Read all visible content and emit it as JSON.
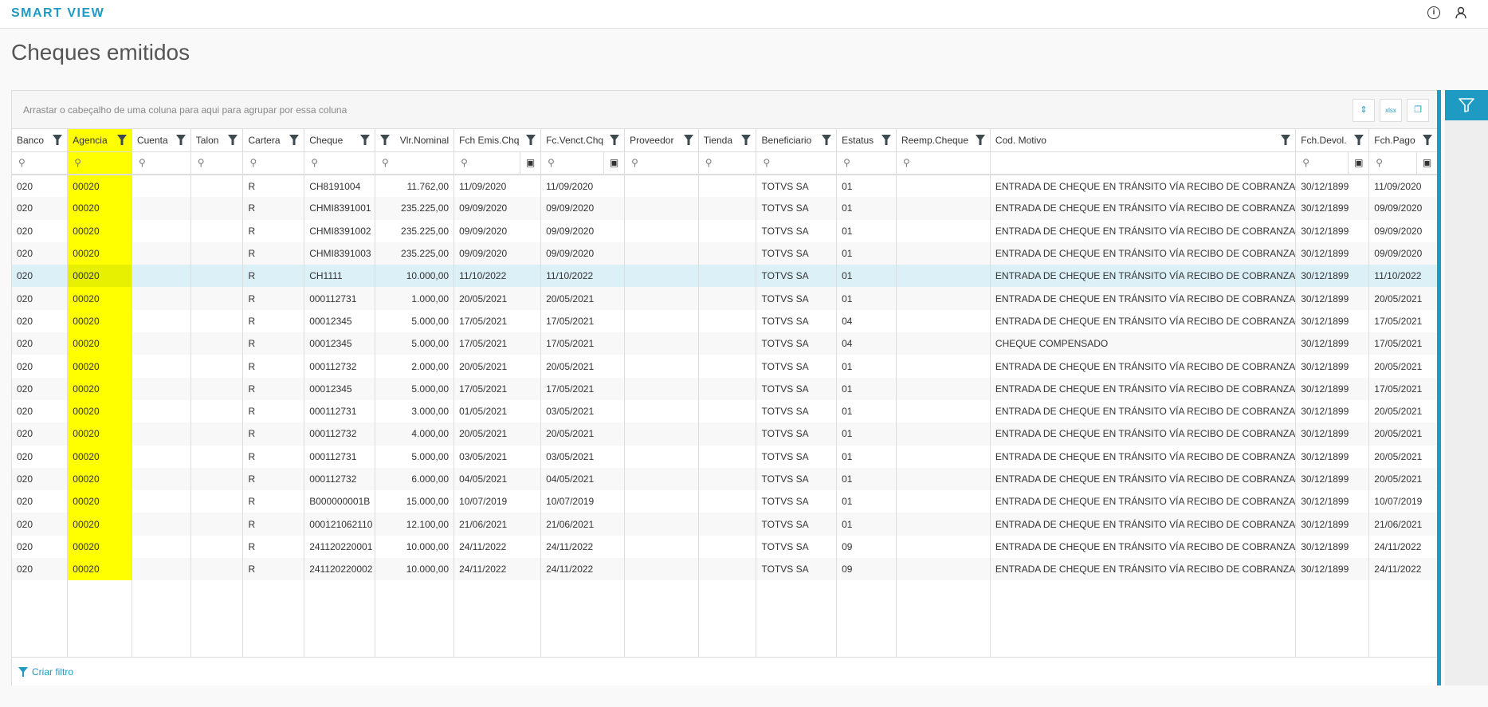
{
  "app": {
    "brand": "SMART VIEW",
    "info_icon": "info-icon",
    "user_icon": "user-icon"
  },
  "page": {
    "title": "Cheques emitidos"
  },
  "grid": {
    "group_hint": "Arrastar o cabeçalho de uma coluna para aqui para agrupar por essa coluna",
    "toolbar": {
      "compact_icon": "row-height-icon",
      "xlsx_icon": "export-xlsx-icon",
      "columns_icon": "columns-icon"
    },
    "highlight_color": "#ffff00",
    "accent_color": "#1f9ac2",
    "columns": [
      "Banco",
      "Agencia",
      "Cuenta",
      "Talon",
      "Cartera",
      "Cheque",
      "Vlr.Nominal",
      "Fch Emis.Chq",
      "Fc.Venct.Chq",
      "Proveedor",
      "Tienda",
      "Beneficiario",
      "Estatus",
      "Reemp.Cheque",
      "Cod. Motivo",
      "Fch.Devol.",
      "Fch.Pago"
    ],
    "selected_row": 4,
    "rows": [
      [
        "020",
        "00020",
        "",
        "",
        "R",
        "CH8191004",
        "11.762,00",
        "11/09/2020",
        "11/09/2020",
        "",
        "",
        "TOTVS SA",
        "01",
        "",
        "ENTRADA DE CHEQUE EN TRÁNSITO VÍA RECIBO DE COBRANZA",
        "30/12/1899",
        "11/09/2020"
      ],
      [
        "020",
        "00020",
        "",
        "",
        "R",
        "CHMI8391001",
        "235.225,00",
        "09/09/2020",
        "09/09/2020",
        "",
        "",
        "TOTVS SA",
        "01",
        "",
        "ENTRADA DE CHEQUE EN TRÁNSITO VÍA RECIBO DE COBRANZA",
        "30/12/1899",
        "09/09/2020"
      ],
      [
        "020",
        "00020",
        "",
        "",
        "R",
        "CHMI8391002",
        "235.225,00",
        "09/09/2020",
        "09/09/2020",
        "",
        "",
        "TOTVS SA",
        "01",
        "",
        "ENTRADA DE CHEQUE EN TRÁNSITO VÍA RECIBO DE COBRANZA",
        "30/12/1899",
        "09/09/2020"
      ],
      [
        "020",
        "00020",
        "",
        "",
        "R",
        "CHMI8391003",
        "235.225,00",
        "09/09/2020",
        "09/09/2020",
        "",
        "",
        "TOTVS SA",
        "01",
        "",
        "ENTRADA DE CHEQUE EN TRÁNSITO VÍA RECIBO DE COBRANZA",
        "30/12/1899",
        "09/09/2020"
      ],
      [
        "020",
        "00020",
        "",
        "",
        "R",
        "CH1111",
        "10.000,00",
        "11/10/2022",
        "11/10/2022",
        "",
        "",
        "TOTVS SA",
        "01",
        "",
        "ENTRADA DE CHEQUE EN TRÁNSITO VÍA RECIBO DE COBRANZA",
        "30/12/1899",
        "11/10/2022"
      ],
      [
        "020",
        "00020",
        "",
        "",
        "R",
        "000112731",
        "1.000,00",
        "20/05/2021",
        "20/05/2021",
        "",
        "",
        "TOTVS SA",
        "01",
        "",
        "ENTRADA DE CHEQUE EN TRÁNSITO VÍA RECIBO DE COBRANZA",
        "30/12/1899",
        "20/05/2021"
      ],
      [
        "020",
        "00020",
        "",
        "",
        "R",
        "00012345",
        "5.000,00",
        "17/05/2021",
        "17/05/2021",
        "",
        "",
        "TOTVS SA",
        "04",
        "",
        "ENTRADA DE CHEQUE EN TRÁNSITO VÍA RECIBO DE COBRANZA",
        "30/12/1899",
        "17/05/2021"
      ],
      [
        "020",
        "00020",
        "",
        "",
        "R",
        "00012345",
        "5.000,00",
        "17/05/2021",
        "17/05/2021",
        "",
        "",
        "TOTVS SA",
        "04",
        "",
        "CHEQUE COMPENSADO",
        "30/12/1899",
        "17/05/2021"
      ],
      [
        "020",
        "00020",
        "",
        "",
        "R",
        "000112732",
        "2.000,00",
        "20/05/2021",
        "20/05/2021",
        "",
        "",
        "TOTVS SA",
        "01",
        "",
        "ENTRADA DE CHEQUE EN TRÁNSITO VÍA RECIBO DE COBRANZA",
        "30/12/1899",
        "20/05/2021"
      ],
      [
        "020",
        "00020",
        "",
        "",
        "R",
        "00012345",
        "5.000,00",
        "17/05/2021",
        "17/05/2021",
        "",
        "",
        "TOTVS SA",
        "01",
        "",
        "ENTRADA DE CHEQUE EN TRÁNSITO VÍA RECIBO DE COBRANZA",
        "30/12/1899",
        "17/05/2021"
      ],
      [
        "020",
        "00020",
        "",
        "",
        "R",
        "000112731",
        "3.000,00",
        "01/05/2021",
        "03/05/2021",
        "",
        "",
        "TOTVS SA",
        "01",
        "",
        "ENTRADA DE CHEQUE EN TRÁNSITO VÍA RECIBO DE COBRANZA",
        "30/12/1899",
        "20/05/2021"
      ],
      [
        "020",
        "00020",
        "",
        "",
        "R",
        "000112732",
        "4.000,00",
        "20/05/2021",
        "20/05/2021",
        "",
        "",
        "TOTVS SA",
        "01",
        "",
        "ENTRADA DE CHEQUE EN TRÁNSITO VÍA RECIBO DE COBRANZA",
        "30/12/1899",
        "20/05/2021"
      ],
      [
        "020",
        "00020",
        "",
        "",
        "R",
        "000112731",
        "5.000,00",
        "03/05/2021",
        "03/05/2021",
        "",
        "",
        "TOTVS SA",
        "01",
        "",
        "ENTRADA DE CHEQUE EN TRÁNSITO VÍA RECIBO DE COBRANZA",
        "30/12/1899",
        "20/05/2021"
      ],
      [
        "020",
        "00020",
        "",
        "",
        "R",
        "000112732",
        "6.000,00",
        "04/05/2021",
        "04/05/2021",
        "",
        "",
        "TOTVS SA",
        "01",
        "",
        "ENTRADA DE CHEQUE EN TRÁNSITO VÍA RECIBO DE COBRANZA",
        "30/12/1899",
        "20/05/2021"
      ],
      [
        "020",
        "00020",
        "",
        "",
        "R",
        "B000000001B",
        "15.000,00",
        "10/07/2019",
        "10/07/2019",
        "",
        "",
        "TOTVS SA",
        "01",
        "",
        "ENTRADA DE CHEQUE EN TRÁNSITO VÍA RECIBO DE COBRANZA",
        "30/12/1899",
        "10/07/2019"
      ],
      [
        "020",
        "00020",
        "",
        "",
        "R",
        "000121062110",
        "12.100,00",
        "21/06/2021",
        "21/06/2021",
        "",
        "",
        "TOTVS SA",
        "01",
        "",
        "ENTRADA DE CHEQUE EN TRÁNSITO VÍA RECIBO DE COBRANZA",
        "30/12/1899",
        "21/06/2021"
      ],
      [
        "020",
        "00020",
        "",
        "",
        "R",
        "241120220001",
        "10.000,00",
        "24/11/2022",
        "24/11/2022",
        "",
        "",
        "TOTVS SA",
        "09",
        "",
        "ENTRADA DE CHEQUE EN TRÁNSITO VÍA RECIBO DE COBRANZA",
        "30/12/1899",
        "24/11/2022"
      ],
      [
        "020",
        "00020",
        "",
        "",
        "R",
        "241120220002",
        "10.000,00",
        "24/11/2022",
        "24/11/2022",
        "",
        "",
        "TOTVS SA",
        "09",
        "",
        "ENTRADA DE CHEQUE EN TRÁNSITO VÍA RECIBO DE COBRANZA",
        "30/12/1899",
        "24/11/2022"
      ]
    ],
    "footer": {
      "create_filter": "Criar filtro"
    }
  },
  "side_panel": {
    "filter_icon": "filter-icon"
  }
}
